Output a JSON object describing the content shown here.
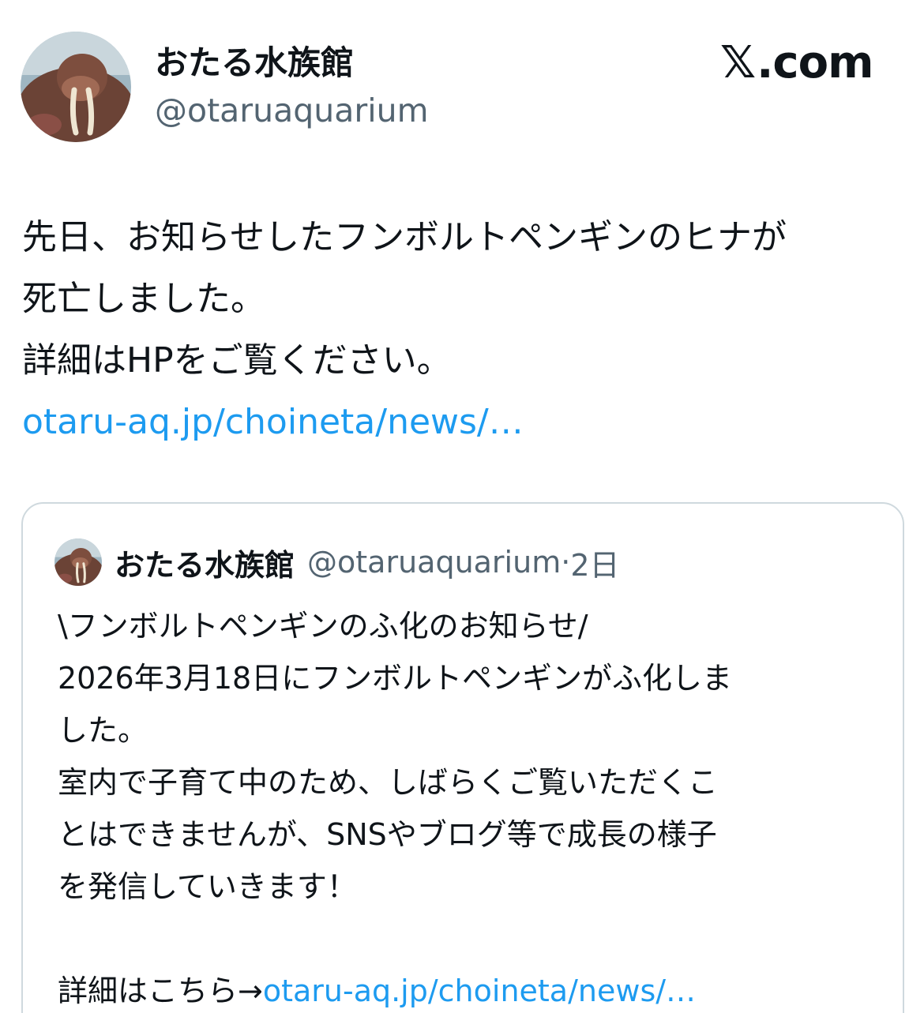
{
  "author": {
    "display_name": "おたる水族館",
    "handle": "@otaruaquarium"
  },
  "brand": {
    "label": "𝕏.com",
    "x_glyph": "𝕏",
    "suffix": ".com"
  },
  "post": {
    "lines": [
      "先日、お知らせしたフンボルトペンギンのヒナが",
      "死亡しました。",
      "詳細はHPをご覧ください。"
    ],
    "link": "otaru-aq.jp/choineta/news/…"
  },
  "quoted": {
    "display_name": "おたる水族館",
    "handle": "@otaruaquarium",
    "separator": "·",
    "time": "2日",
    "lines": [
      "\\フンボルトペンギンのふ化のお知らせ/",
      "2026年3月18日にフンボルトペンギンがふ化しま",
      "した。",
      "室内で子育て中のため、しばらくご覧いただくこ",
      "とはできませんが、SNSやブログ等で成長の様子",
      "を発信していきます！",
      ""
    ],
    "detail_prefix": "詳細はこちら→",
    "detail_link": "otaru-aq.jp/choineta/news/…"
  },
  "colors": {
    "link": "#1d9bf0",
    "secondary_text": "#536471",
    "border": "#cfd9de"
  }
}
